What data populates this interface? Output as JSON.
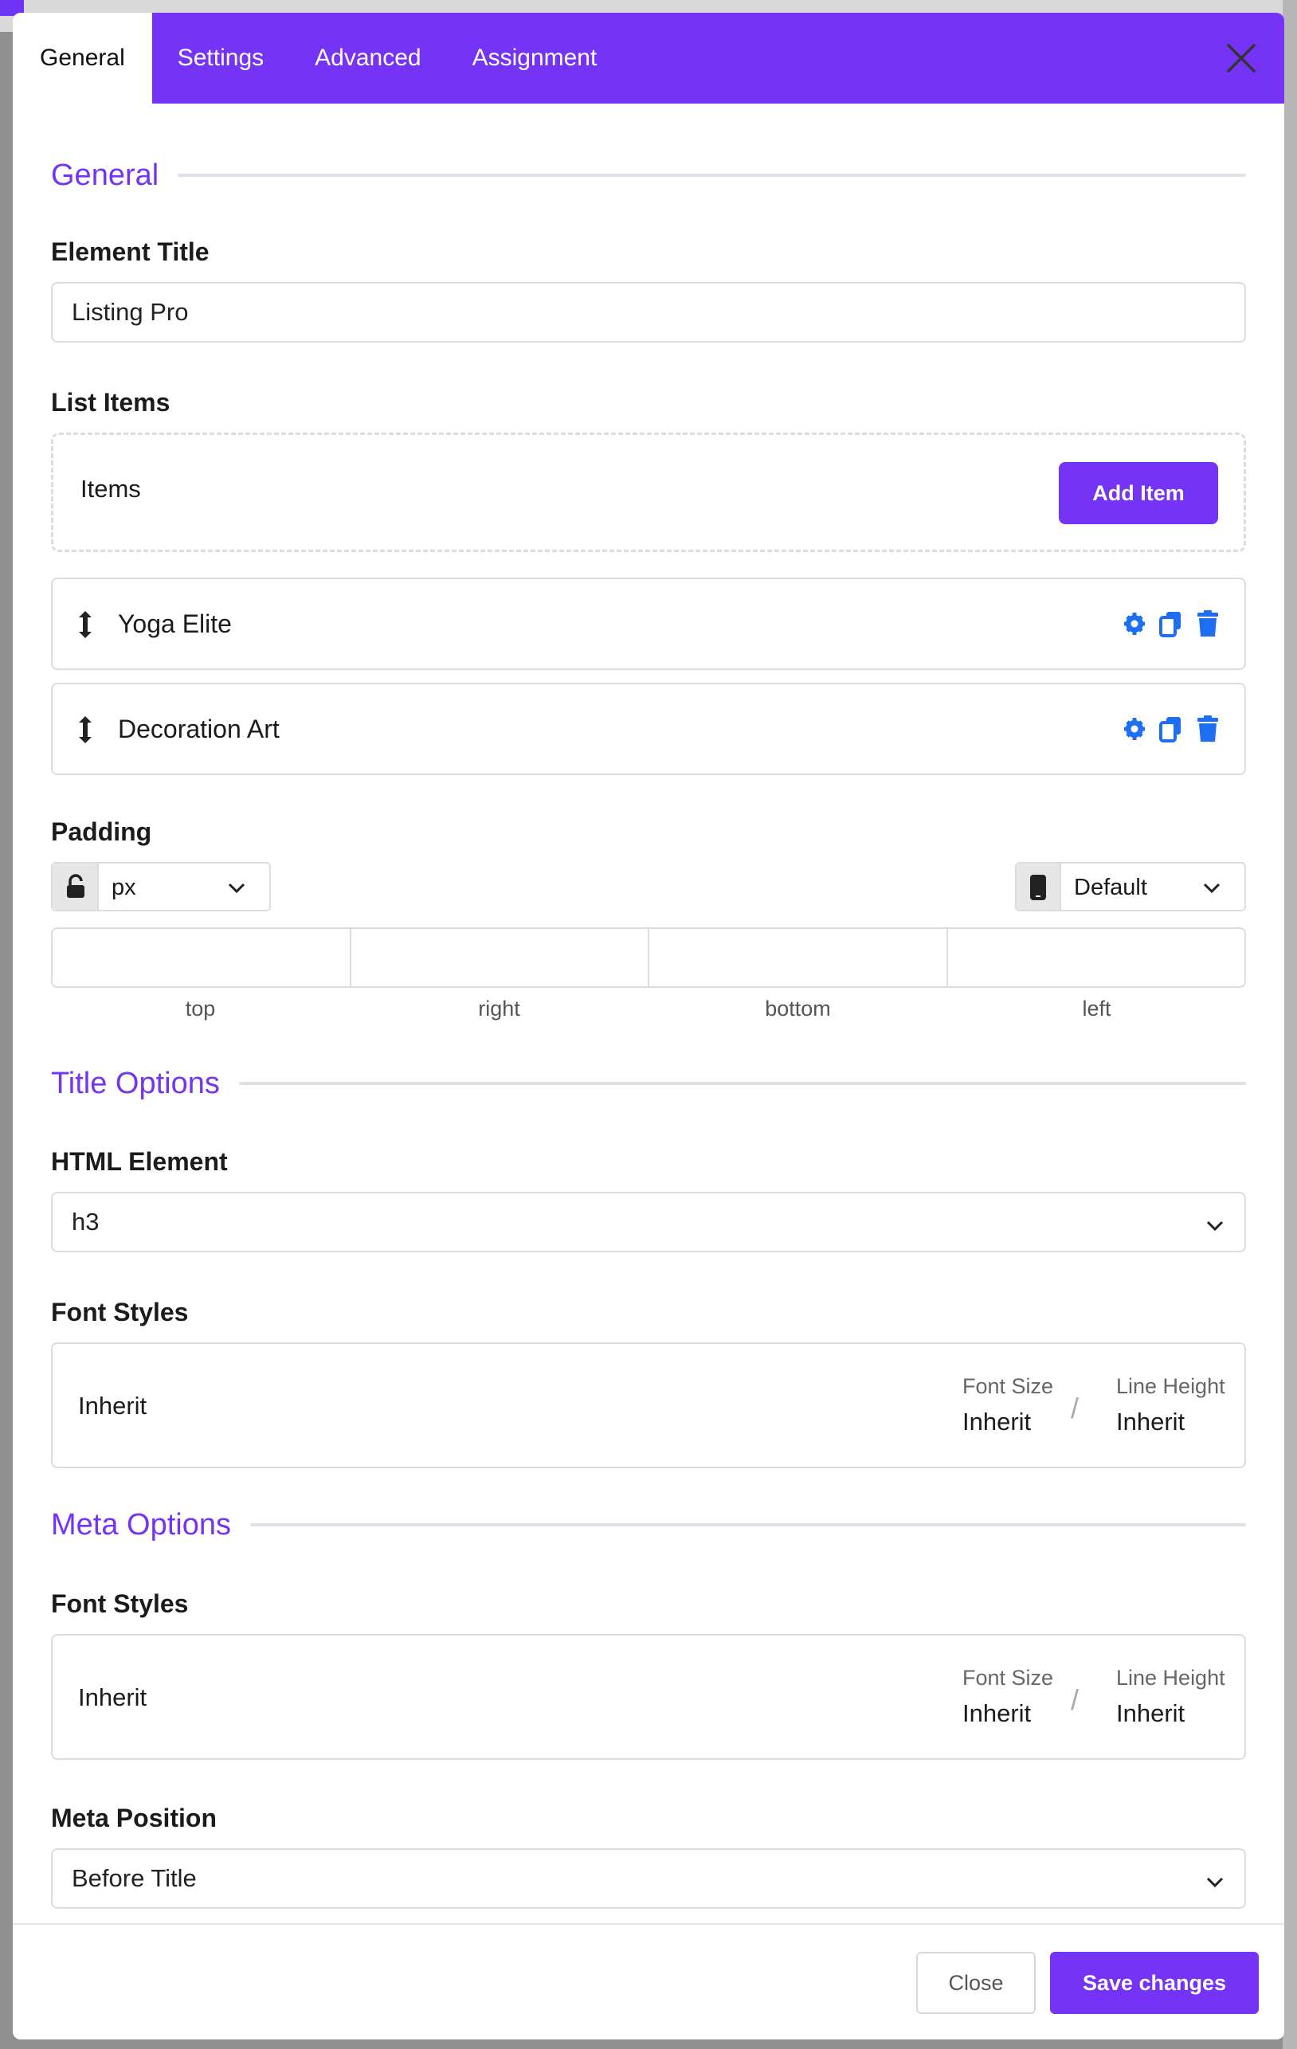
{
  "tabs": [
    {
      "label": "General",
      "active": true
    },
    {
      "label": "Settings",
      "active": false
    },
    {
      "label": "Advanced",
      "active": false
    },
    {
      "label": "Assignment",
      "active": false
    }
  ],
  "general": {
    "section_title": "General",
    "element_title_label": "Element Title",
    "element_title_value": "Listing Pro",
    "list_items_label": "List Items",
    "items_label": "Items",
    "add_item_label": "Add Item",
    "items": [
      {
        "name": "Yoga Elite"
      },
      {
        "name": "Decoration Art"
      }
    ],
    "padding_label": "Padding",
    "padding_unit": "px",
    "padding_device": "Default",
    "padding_sides": [
      "top",
      "right",
      "bottom",
      "left"
    ]
  },
  "title_options": {
    "section_title": "Title Options",
    "html_element_label": "HTML Element",
    "html_element_value": "h3",
    "font_styles_label": "Font Styles",
    "font_family": "Inherit",
    "font_size_label": "Font Size",
    "font_size_value": "Inherit",
    "line_height_label": "Line Height",
    "line_height_value": "Inherit",
    "separator": "/"
  },
  "meta_options": {
    "section_title": "Meta Options",
    "font_styles_label": "Font Styles",
    "font_family": "Inherit",
    "font_size_label": "Font Size",
    "font_size_value": "Inherit",
    "line_height_label": "Line Height",
    "line_height_value": "Inherit",
    "separator": "/",
    "meta_position_label": "Meta Position",
    "meta_position_value": "Before Title"
  },
  "footer": {
    "close_label": "Close",
    "save_label": "Save changes"
  },
  "colors": {
    "accent": "#7433f5",
    "action_icon": "#1e6ef2"
  }
}
